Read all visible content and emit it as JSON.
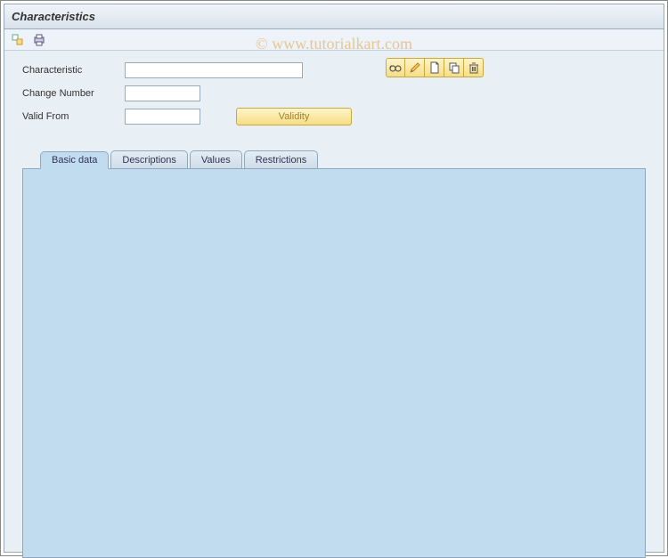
{
  "header": {
    "title": "Characteristics"
  },
  "toolbar": {
    "icons": [
      "toggle-icon",
      "print-preview-icon"
    ]
  },
  "form": {
    "characteristic": {
      "label": "Characteristic",
      "value": ""
    },
    "change_number": {
      "label": "Change Number",
      "value": ""
    },
    "valid_from": {
      "label": "Valid From",
      "value": ""
    },
    "validity_button": "Validity"
  },
  "actions": {
    "display": "display-icon",
    "change": "change-icon",
    "create": "create-icon",
    "copy": "copy-icon",
    "delete": "delete-icon"
  },
  "tabs": {
    "items": [
      {
        "label": "Basic data",
        "active": true
      },
      {
        "label": "Descriptions",
        "active": false
      },
      {
        "label": "Values",
        "active": false
      },
      {
        "label": "Restrictions",
        "active": false
      }
    ]
  },
  "watermark": "© www.tutorialkart.com"
}
